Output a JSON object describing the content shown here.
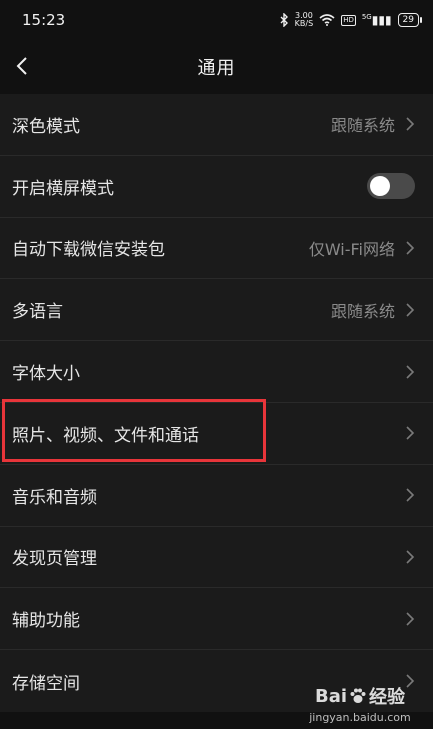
{
  "status": {
    "time": "15:23",
    "net_speed_value": "3.00",
    "net_speed_unit": "KB/S",
    "hd": "HD",
    "signal": "5G",
    "battery": "29"
  },
  "nav": {
    "title": "通用"
  },
  "settings": {
    "rows": [
      {
        "label": "深色模式",
        "value": "跟随系统"
      },
      {
        "label": "开启横屏模式",
        "toggle": false
      },
      {
        "label": "自动下载微信安装包",
        "value": "仅Wi-Fi网络"
      },
      {
        "label": "多语言",
        "value": "跟随系统"
      },
      {
        "label": "字体大小",
        "value": ""
      },
      {
        "label": "照片、视频、文件和通话",
        "value": ""
      },
      {
        "label": "音乐和音频",
        "value": ""
      },
      {
        "label": "发现页管理",
        "value": ""
      },
      {
        "label": "辅助功能",
        "value": ""
      },
      {
        "label": "存储空间",
        "value": ""
      }
    ]
  },
  "watermark": {
    "brand_left": "Bai",
    "brand_right": "经验",
    "url": "jingyan.baidu.com"
  },
  "colors": {
    "highlight": "#e8353a"
  }
}
